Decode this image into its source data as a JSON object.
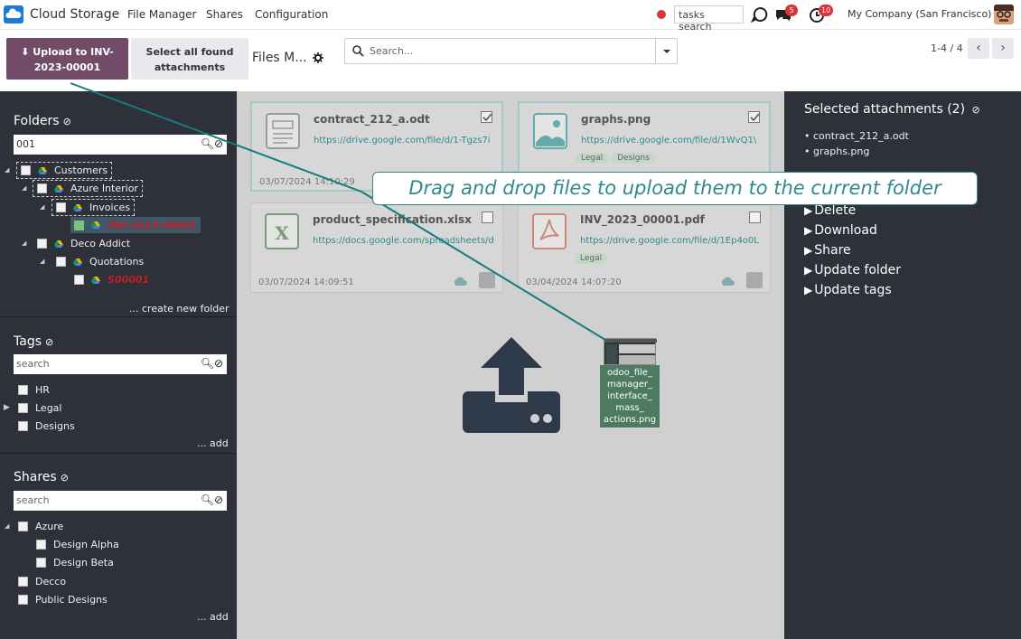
{
  "navbar": {
    "app_name": "Cloud Storage",
    "menu": [
      "File Manager",
      "Shares",
      "Configuration"
    ],
    "tasks_search": "tasks search",
    "messages_count": "5",
    "activities_count": "10",
    "company": "My Company (San Francisco)"
  },
  "control_panel": {
    "upload_line1": "Upload to INV-",
    "upload_line2": "2023-00001",
    "select_all_line1": "Select all found",
    "select_all_line2": "attachments",
    "breadcrumb": "Files M...",
    "search_placeholder": "Search...",
    "pager": "1-4 / 4"
  },
  "folders": {
    "title": "Folders",
    "search_value": "001",
    "items": [
      {
        "label": "Customers"
      },
      {
        "label": "Azure Interior"
      },
      {
        "label": "Invoices"
      },
      {
        "label": "INV-2023-00001"
      },
      {
        "label": "Deco Addict"
      },
      {
        "label": "Quotations"
      },
      {
        "label": "S00001"
      }
    ],
    "create_link": "... create new folder"
  },
  "tags": {
    "title": "Tags",
    "search_placeholder": "search",
    "items": [
      {
        "label": "HR"
      },
      {
        "label": "Legal"
      },
      {
        "label": "Designs"
      }
    ],
    "add_link": "... add"
  },
  "shares": {
    "title": "Shares",
    "search_placeholder": "search",
    "items": [
      {
        "label": "Azure"
      },
      {
        "label": "Design Alpha"
      },
      {
        "label": "Design Beta"
      },
      {
        "label": "Decco"
      },
      {
        "label": "Public Designs"
      }
    ],
    "add_link": "... add"
  },
  "files": [
    {
      "name": "contract_212_a.odt",
      "url": "https://drive.google.com/file/d/1-Tgzs7i",
      "date": "03/07/2024 14:10:29",
      "tags": []
    },
    {
      "name": "graphs.png",
      "url": "https://drive.google.com/file/d/1WvQ1\\",
      "date": "",
      "tags": [
        "Legal",
        "Designs"
      ]
    },
    {
      "name": "product_specification.xlsx",
      "url": "https://docs.google.com/spreadsheets/d",
      "date": "03/07/2024 14:09:51",
      "tags": []
    },
    {
      "name": "INV_2023_00001.pdf",
      "url": "https://drive.google.com/file/d/1Ep4o0L",
      "date": "03/04/2024 14:07:20",
      "tags": [
        "Legal"
      ]
    }
  ],
  "dragged_file": {
    "label_lines": [
      "odoo_file_",
      "manager_",
      "interface_",
      "mass_",
      "actions.png"
    ]
  },
  "selected_panel": {
    "title": "Selected attachments (2)",
    "items": [
      "contract_212_a.odt",
      "graphs.png"
    ],
    "actions": [
      "Delete",
      "Download",
      "Share",
      "Update folder",
      "Update tags"
    ]
  },
  "callout": {
    "text": "Drag and drop files to upload them to the current folder"
  },
  "colors": {
    "brand": "#714b67",
    "sidebar": "#2e3139",
    "accent": "#2f8a8a",
    "badge": "#d9343a"
  }
}
